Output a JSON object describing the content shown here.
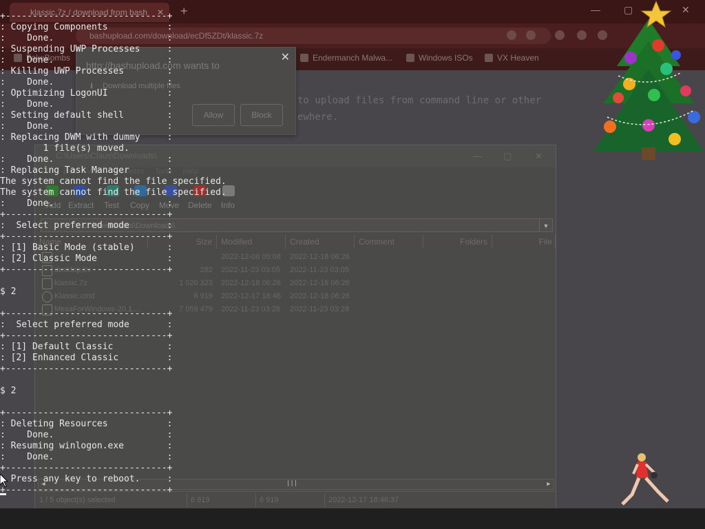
{
  "browser": {
    "tab_title": "klassic.7z / download from bash",
    "address": "bashupload.com/download/ecDf5ZDt/klassic.7z",
    "bookmarks": [
      "FakeBombs",
      "Endermanch Malwa...",
      "Windows ISOs",
      "VX Heaven"
    ],
    "page_text_1": "to upload files from command line or other",
    "page_text_2": "ewhere."
  },
  "permission_popup": {
    "message": "http://bashupload.com wants to",
    "item": "Download multiple files",
    "allow_label": "Allow",
    "block_label": "Block",
    "close_glyph": "✕"
  },
  "file_manager": {
    "title": "C:\\Users\\Claus\\Downloads\\",
    "menu": [
      "File",
      "Edit",
      "View",
      "Favorites",
      "Tools",
      "Help"
    ],
    "toolbar": [
      {
        "label": "Add",
        "color": "#2f7a2f"
      },
      {
        "label": "Extract",
        "color": "#2f4f9a"
      },
      {
        "label": "Test",
        "color": "#2f7a6a"
      },
      {
        "label": "Copy",
        "color": "#2f6a9a"
      },
      {
        "label": "Move",
        "color": "#3a4fa0"
      },
      {
        "label": "Delete",
        "color": "#a02f2f"
      },
      {
        "label": "Info",
        "color": "#7a7a7a"
      }
    ],
    "path": "C:\\Users\\Claus\\Downloads\\",
    "columns": [
      "Name",
      "Size",
      "Modified",
      "Created",
      "Comment",
      "Folders",
      "File"
    ],
    "rows": [
      {
        "name": "",
        "size": "",
        "modified": "2022-12-08 05:08",
        "created": "2022-12-18 06:26"
      },
      {
        "name": "desktop.ini",
        "size": "282",
        "modified": "2022-11-23 03:05",
        "created": "2022-11-23 03:05"
      },
      {
        "name": "klassic.7z",
        "size": "1 020 323",
        "modified": "2022-12-18 06:26",
        "created": "2022-12-18 06:26"
      },
      {
        "name": "Klassic.cmd",
        "size": "6 919",
        "modified": "2022-12-17 18:46",
        "created": "2022-12-18 06:26"
      },
      {
        "name": "MesaForWindows-20.1....",
        "size": "7 059 479",
        "modified": "2022-11-23 03:28",
        "created": "2022-11-23 03:28"
      }
    ],
    "status": {
      "selected": "1 / 5 object(s) selected",
      "size": "6 919",
      "packed": "6 919",
      "date": "2022-12-17 18:46:37"
    }
  },
  "console": {
    "lines": [
      "+------------------------------+",
      ": Copying Components           :",
      ":    Done.                     :",
      ": Suspending UWP Processes     :",
      ":    Done.                     :",
      ": Killing UWP Processes        :",
      ":    Done.                     :",
      ": Optimizing LogonUI           :",
      ":    Done.                     :",
      ": Setting default shell        :",
      ":    Done.                     :",
      ": Replacing DWM with dummy     :",
      "        1 file(s) moved.",
      ":    Done.                     :",
      ": Replacing Task Manager       :",
      "The system cannot find the file specified.",
      "The system cannot find the file specified.",
      ":    Done.                     :",
      "+------------------------------+",
      ":  Select preferred mode       :",
      "+------------------------------+",
      ": [1] Basic Mode (stable)      :",
      ": [2] Classic Mode             :",
      "+------------------------------+",
      "",
      "$ 2",
      "",
      "+------------------------------+",
      ":  Select preferred mode       :",
      "+------------------------------+",
      ": [1] Default Classic          :",
      ": [2] Enhanced Classic         :",
      "+------------------------------+",
      "",
      "$ 2",
      "",
      "+------------------------------+",
      ": Deleting Resources           :",
      ":    Done.                     :",
      ": Resuming winlogon.exe        :",
      ":    Done.                     :",
      "+------------------------------+",
      ": Press any key to reboot.     :",
      "+------------------------------+"
    ]
  },
  "colors": {
    "console_text": "#e8e8e8",
    "taskbar": "#1f1f1f",
    "tree_green": "#1f7a2a",
    "star": "#f2c53a"
  }
}
